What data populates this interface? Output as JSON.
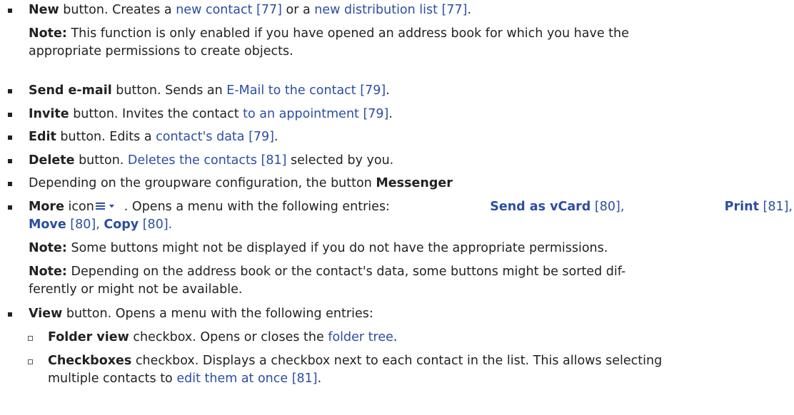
{
  "items": {
    "new": {
      "label": "New",
      "t1": " button. Creates a ",
      "link1": "new contact [77]",
      "t2": " or a ",
      "link2": "new distribution list [77]",
      "t3": ".",
      "note_label": "Note:",
      "note_text_1": " This function is only enabled if you have opened an address book for which you have the",
      "note_text_2": "appropriate permissions to create objects."
    },
    "send": {
      "label": "Send e-mail",
      "t1": " button. Sends an ",
      "link1": "E-Mail to the contact [79]",
      "t2": "."
    },
    "invite": {
      "label": "Invite",
      "t1": " button. Invites the contact ",
      "link1": "to an appointment [79]",
      "t2": "."
    },
    "edit": {
      "label": "Edit",
      "t1": " button. Edits a ",
      "link1": "contact's data [79]",
      "t2": "."
    },
    "delete": {
      "label": "Delete",
      "t1": " button. ",
      "link1": "Deletes the contacts [81]",
      "t2": " selected by you."
    },
    "messenger": {
      "t1": "Depending on the groupware configuration, the button ",
      "label": "Messenger"
    },
    "more": {
      "label": "More",
      "t1": " icon",
      "icon": "menu-dropdown-icon",
      "t2": ". Opens a menu with the following entries: ",
      "e1": "Send as vCard",
      "r1": " [80],",
      "e2": "Print",
      "r2": " [81],",
      "e3": "Move",
      "r3": " [80],",
      "e4": "Copy",
      "r4": " [80].",
      "note1_label": "Note:",
      "note1_text": " Some buttons might not be displayed if you do not have the appropriate permissions.",
      "note2_label": "Note:",
      "note2_text_1": " Depending on the address book or the contact's data, some buttons might be sorted dif-",
      "note2_text_2": "ferently or might not be available."
    },
    "view": {
      "label": "View",
      "t1": " button. Opens a menu with the following entries:",
      "sub": [
        {
          "label": "Folder view",
          "t1": " checkbox. Opens or closes the ",
          "link1": "folder tree",
          "t2": "."
        },
        {
          "label": "Checkboxes",
          "t1": " checkbox. Displays a checkbox next to each contact in the list. This allows selecting",
          "t2": "multiple contacts to ",
          "link1": "edit them at once [81]",
          "t3": "."
        }
      ]
    }
  },
  "colors": {
    "text": "#222222",
    "link": "#2b4ea2",
    "icon": "#2b4ea2"
  }
}
